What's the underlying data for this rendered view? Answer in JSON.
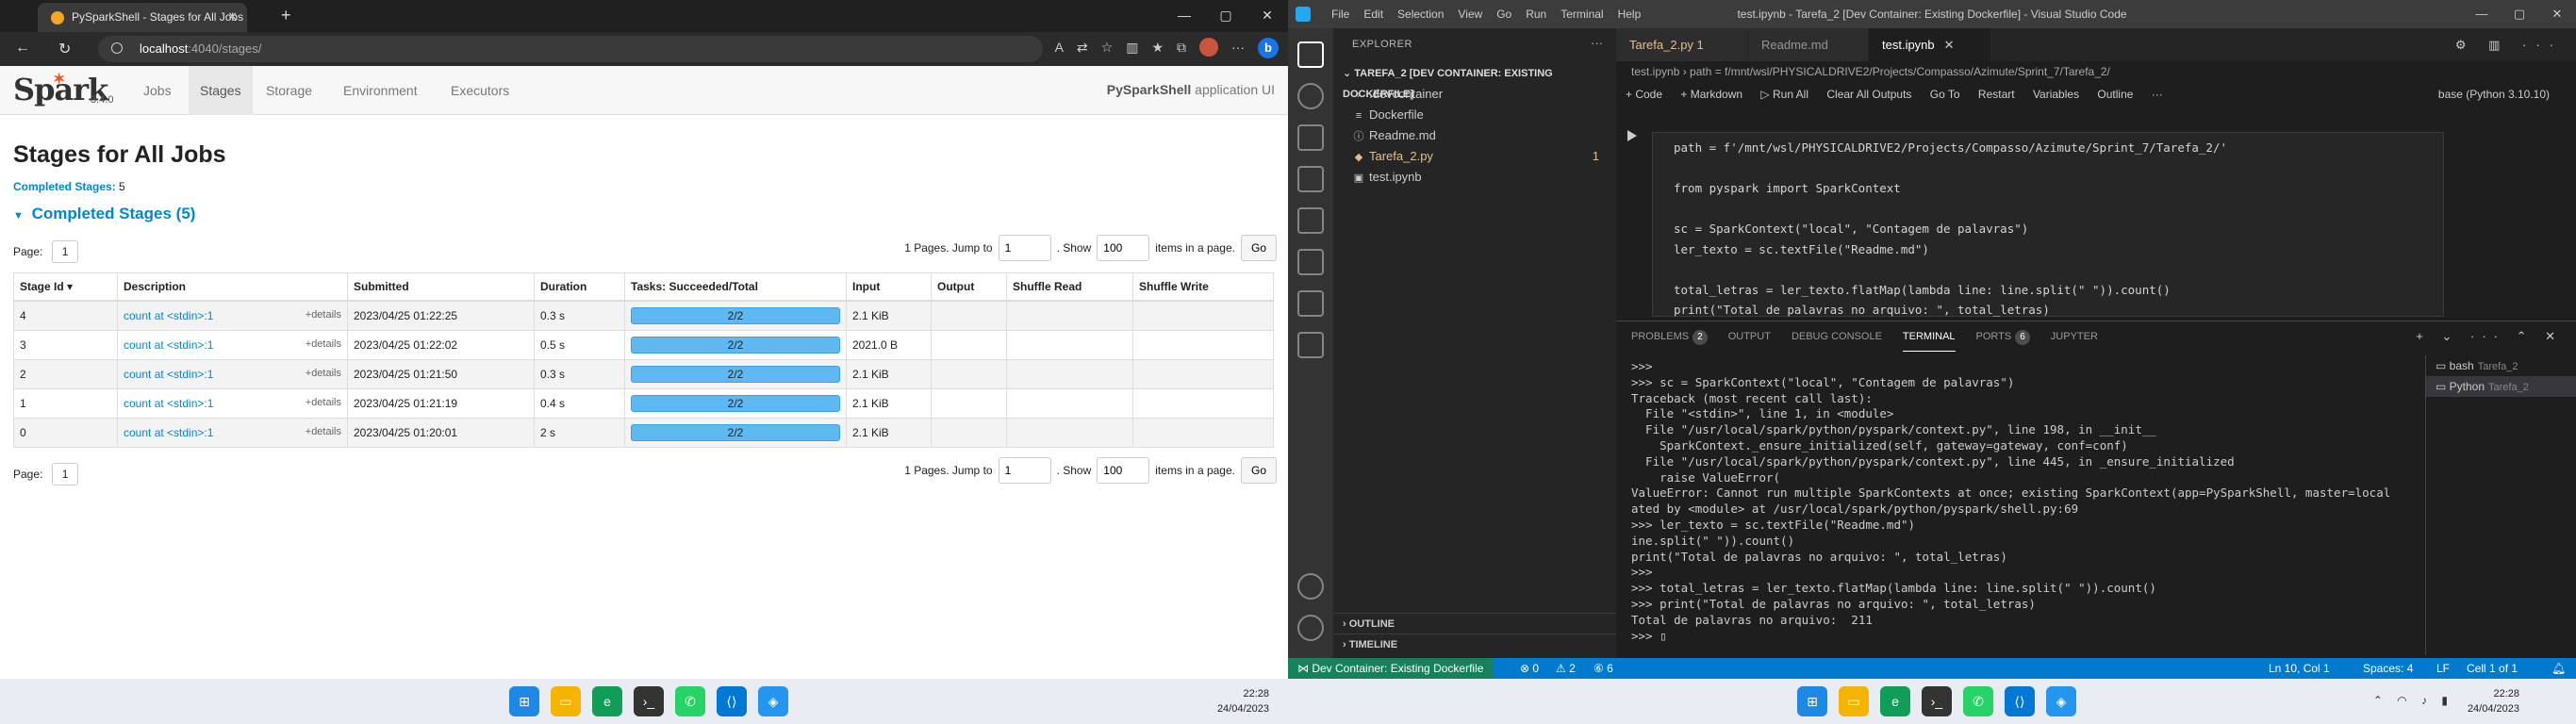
{
  "left_screen": {
    "browser": {
      "tab_title": "PySparkShell - Stages for All Jobs",
      "url_host": "localhost",
      "url_path": ":4040/stages/"
    },
    "spark": {
      "logo_text": "Spark",
      "version": "3.4.0",
      "nav_tabs": [
        "Jobs",
        "Stages",
        "Storage",
        "Environment",
        "Executors"
      ],
      "active_tab": "Stages",
      "app_name": "PySparkShell",
      "app_suffix": "application UI",
      "page_title": "Stages for All Jobs",
      "completed_summary_label": "Completed Stages:",
      "completed_summary_value": "5",
      "section_header": "Completed Stages (5)",
      "pager": {
        "page_label": "Page:",
        "page_value": "1",
        "pages_text": "1 Pages. Jump to",
        "jump_value": "1",
        "show_label": ". Show",
        "show_value": "100",
        "items_text": "items in a page.",
        "go_label": "Go"
      },
      "table": {
        "columns": [
          "Stage Id ▾",
          "Description",
          "Submitted",
          "Duration",
          "Tasks: Succeeded/Total",
          "Input",
          "Output",
          "Shuffle Read",
          "Shuffle Write"
        ],
        "details_label": "+details",
        "rows": [
          {
            "id": "4",
            "desc": "count at <stdin>:1",
            "submitted": "2023/04/25 01:22:25",
            "duration": "0.3 s",
            "tasks": "2/2",
            "input": "2.1 KiB",
            "output": "",
            "shuffle_read": "",
            "shuffle_write": ""
          },
          {
            "id": "3",
            "desc": "count at <stdin>:1",
            "submitted": "2023/04/25 01:22:02",
            "duration": "0.5 s",
            "tasks": "2/2",
            "input": "2021.0 B",
            "output": "",
            "shuffle_read": "",
            "shuffle_write": ""
          },
          {
            "id": "2",
            "desc": "count at <stdin>:1",
            "submitted": "2023/04/25 01:21:50",
            "duration": "0.3 s",
            "tasks": "2/2",
            "input": "2.1 KiB",
            "output": "",
            "shuffle_read": "",
            "shuffle_write": ""
          },
          {
            "id": "1",
            "desc": "count at <stdin>:1",
            "submitted": "2023/04/25 01:21:19",
            "duration": "0.4 s",
            "tasks": "2/2",
            "input": "2.1 KiB",
            "output": "",
            "shuffle_read": "",
            "shuffle_write": ""
          },
          {
            "id": "0",
            "desc": "count at <stdin>:1",
            "submitted": "2023/04/25 01:20:01",
            "duration": "2 s",
            "tasks": "2/2",
            "input": "2.1 KiB",
            "output": "",
            "shuffle_read": "",
            "shuffle_write": ""
          }
        ]
      }
    },
    "taskbar": {
      "time": "22:28",
      "date": "24/04/2023"
    }
  },
  "right_screen": {
    "window_title": "test.ipynb - Tarefa_2 [Dev Container: Existing Dockerfile] - Visual Studio Code",
    "menu": [
      "File",
      "Edit",
      "Selection",
      "View",
      "Go",
      "Run",
      "Terminal",
      "Help"
    ],
    "explorer": {
      "title": "EXPLORER",
      "folder": "TAREFA_2 [DEV CONTAINER: EXISTING DOCKERFILE]",
      "items": [
        {
          "label": ".devcontainer",
          "icon": "chevron-right-icon",
          "glyph": "›",
          "modified": false,
          "badge": ""
        },
        {
          "label": "Dockerfile",
          "icon": "docker-file-icon",
          "glyph": "≡",
          "modified": false,
          "badge": ""
        },
        {
          "label": "Readme.md",
          "icon": "markdown-file-icon",
          "glyph": "ⓘ",
          "modified": false,
          "badge": ""
        },
        {
          "label": "Tarefa_2.py",
          "icon": "python-file-icon",
          "glyph": "◆",
          "modified": true,
          "badge": "1"
        },
        {
          "label": "test.ipynb",
          "icon": "notebook-file-icon",
          "glyph": "▣",
          "modified": false,
          "badge": ""
        }
      ],
      "outline": "OUTLINE",
      "timeline": "TIMELINE"
    },
    "editor_tabs": [
      {
        "label": "Tarefa_2.py 1",
        "modified": true,
        "active": false
      },
      {
        "label": "Readme.md",
        "modified": false,
        "active": false
      },
      {
        "label": "test.ipynb",
        "modified": false,
        "active": true
      }
    ],
    "breadcrumb": "test.ipynb  ›  path = f/mnt/wsl/PHYSICALDRIVE2/Projects/Compasso/Azimute/Sprint_7/Tarefa_2/",
    "notebook_toolbar": [
      "+ Code",
      "+ Markdown",
      "▷ Run All",
      "Clear All Outputs",
      "Go To",
      "Restart",
      "Variables",
      "Outline",
      "···"
    ],
    "kernel": "base (Python 3.10.10)",
    "code_lines": [
      {
        "t": "path = f'/mnt/wsl/PHYSICALDRIVE2/Projects/Compasso/Azimute/Sprint_7/Tarefa_2/'"
      },
      {
        "t": ""
      },
      {
        "t": "from pyspark import SparkContext"
      },
      {
        "t": ""
      },
      {
        "t": "sc = SparkContext(\"local\", \"Contagem de palavras\")"
      },
      {
        "t": "ler_texto = sc.textFile(\"Readme.md\")"
      },
      {
        "t": ""
      },
      {
        "t": "total_letras = ler_texto.flatMap(lambda line: line.split(\" \")).count()"
      },
      {
        "t": "print(\"Total de palavras no arquivo: \", total_letras)"
      }
    ],
    "panel": {
      "tabs": [
        "PROBLEMS",
        "OUTPUT",
        "DEBUG CONSOLE",
        "TERMINAL",
        "PORTS",
        "JUPYTER"
      ],
      "problems_count": "2",
      "ports_count": "6",
      "active": "TERMINAL",
      "terminal_lines": [
        ">>>",
        ">>> sc = SparkContext(\"local\", \"Contagem de palavras\")",
        "Traceback (most recent call last):",
        "  File \"<stdin>\", line 1, in <module>",
        "  File \"/usr/local/spark/python/pyspark/context.py\", line 198, in __init__",
        "    SparkContext._ensure_initialized(self, gateway=gateway, conf=conf)",
        "  File \"/usr/local/spark/python/pyspark/context.py\", line 445, in _ensure_initialized",
        "    raise ValueError(",
        "ValueError: Cannot run multiple SparkContexts at once; existing SparkContext(app=PySparkShell, master=local[*]) cre",
        "ated by <module> at /usr/local/spark/python/pyspark/shell.py:69",
        ">>> ler_texto = sc.textFile(\"Readme.md\")",
        "ine.split(\" \")).count()",
        "print(\"Total de palavras no arquivo: \", total_letras)",
        ">>>",
        ">>> total_letras = ler_texto.flatMap(lambda line: line.split(\" \")).count()",
        ">>> print(\"Total de palavras no arquivo: \", total_letras)",
        "Total de palavras no arquivo:  211",
        ">>> ▯"
      ],
      "terminals": [
        {
          "label": "bash",
          "sub": "Tarefa_2"
        },
        {
          "label": "Python",
          "sub": "Tarefa_2"
        }
      ]
    },
    "statusbar": {
      "remote": "Dev Container: Existing Dockerfile",
      "errors": "⊗ 0",
      "warnings": "⚠ 2",
      "ports": "⑥ 6",
      "position": "Ln 10, Col 1",
      "spaces": "Spaces: 4",
      "eol": "LF",
      "cell": "Cell 1 of 1"
    },
    "taskbar": {
      "time": "22:28",
      "date": "24/04/2023"
    }
  },
  "colors": {
    "spark_link": "#0088cc",
    "progress_fill": "#5eb9f2",
    "vscode_status": "#007acc",
    "vscode_remote": "#16825d"
  }
}
